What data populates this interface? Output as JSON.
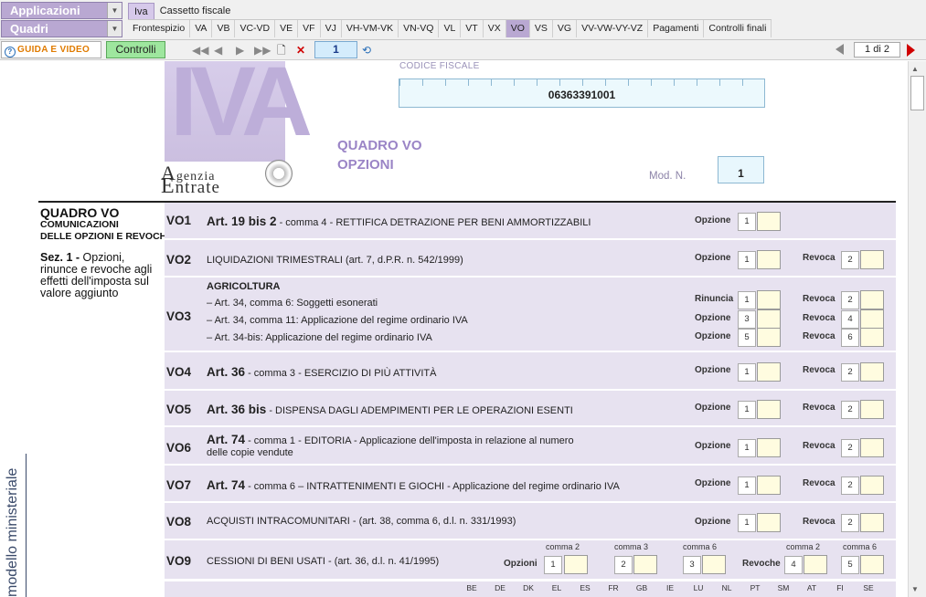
{
  "menu": {
    "applicazioni": "Applicazioni",
    "quadri": "Quadri",
    "tabs_top": [
      "Iva",
      "Cassetto fiscale"
    ],
    "tabs_quadri": [
      "Frontespizio",
      "VA",
      "VB",
      "VC-VD",
      "VE",
      "VF",
      "VJ",
      "VH-VM-VK",
      "VN-VQ",
      "VL",
      "VT",
      "VX",
      "VO",
      "VS",
      "VG",
      "VV-VW-VY-VZ",
      "Pagamenti",
      "Controlli finali"
    ],
    "active_quadro": "VO"
  },
  "toolbar": {
    "guida": "GUIDA E VIDEO",
    "controlli": "Controlli",
    "page_value": "1",
    "pager": "1 di 2"
  },
  "form": {
    "cf_label": "CODICE FISCALE",
    "cf_value": "06363391001",
    "quadro_title_1": "QUADRO VO",
    "quadro_title_2": "OPZIONI",
    "modn_label": "Mod. N.",
    "modn_value": "1",
    "agenzia": "genzia",
    "entrate": "ntrate",
    "side_title": "QUADRO VO",
    "side_sub1": "COMUNICAZIONI",
    "side_sub2": "DELLE OPZIONI E REVOCHE",
    "sez_bold": "Sez. 1 -",
    "sez_text": " Opzioni, rinunce e revoche agli effetti dell'imposta sul valore aggiunto",
    "vertical": "modello ministeriale"
  },
  "rows": {
    "vo1": {
      "code": "VO1",
      "bold": "Art. 19 bis 2",
      "text": " - comma 4 - RETTIFICA DETRAZIONE PER BENI AMMORTIZZABILI",
      "opzione": "Opzione",
      "n1": "1"
    },
    "vo2": {
      "code": "VO2",
      "text": "LIQUIDAZIONI TRIMESTRALI  (art. 7, d.P.R. n. 542/1999)",
      "opzione": "Opzione",
      "revoca": "Revoca",
      "n1": "1",
      "n2": "2"
    },
    "vo3": {
      "code": "VO3",
      "head": "AGRICOLTURA",
      "l1": "– Art. 34, comma   6: Soggetti esonerati",
      "l2": "– Art. 34, comma 11: Applicazione del regime ordinario IVA",
      "l3": "– Art. 34-bis: Applicazione del regime ordinario IVA",
      "rinuncia": "Rinuncia",
      "opzione": "Opzione",
      "revoca": "Revoca",
      "n": [
        "1",
        "2",
        "3",
        "4",
        "5",
        "6"
      ]
    },
    "vo4": {
      "code": "VO4",
      "bold": "Art. 36",
      "text": " - comma 3 - ESERCIZIO DI PIÙ ATTIVITÀ",
      "opzione": "Opzione",
      "revoca": "Revoca",
      "n1": "1",
      "n2": "2"
    },
    "vo5": {
      "code": "VO5",
      "bold": "Art. 36 bis",
      "text": " - DISPENSA DAGLI ADEMPIMENTI PER LE OPERAZIONI ESENTI",
      "opzione": "Opzione",
      "revoca": "Revoca",
      "n1": "1",
      "n2": "2"
    },
    "vo6": {
      "code": "VO6",
      "bold": "Art. 74",
      "text": " - comma 1 - EDITORIA - Applicazione dell'imposta in relazione al numero",
      "text2": "delle copie vendute",
      "opzione": "Opzione",
      "revoca": "Revoca",
      "n1": "1",
      "n2": "2"
    },
    "vo7": {
      "code": "VO7",
      "bold": "Art. 74",
      "text": " - comma    6 – INTRATTENIMENTI E GIOCHI - Applicazione del regime ordinario IVA",
      "opzione": "Opzione",
      "revoca": "Revoca",
      "n1": "1",
      "n2": "2"
    },
    "vo8": {
      "code": "VO8",
      "text": "ACQUISTI INTRACOMUNITARI - (art. 38, comma 6, d.l. n. 331/1993)",
      "opzione": "Opzione",
      "revoca": "Revoca",
      "n1": "1",
      "n2": "2"
    },
    "vo9": {
      "code": "VO9",
      "text": "CESSIONI DI BENI USATI - (art. 36, d.l. n. 41/1995)",
      "opzioni": "Opzioni",
      "revoche": "Revoche",
      "c2": "comma 2",
      "c3": "comma 3",
      "c6": "comma 6",
      "n": [
        "1",
        "2",
        "3",
        "4",
        "5"
      ]
    }
  },
  "countries": [
    "BE",
    "DE",
    "DK",
    "EL",
    "ES",
    "FR",
    "GB",
    "IE",
    "LU",
    "NL",
    "PT",
    "SM",
    "AT",
    "FI",
    "SE"
  ]
}
